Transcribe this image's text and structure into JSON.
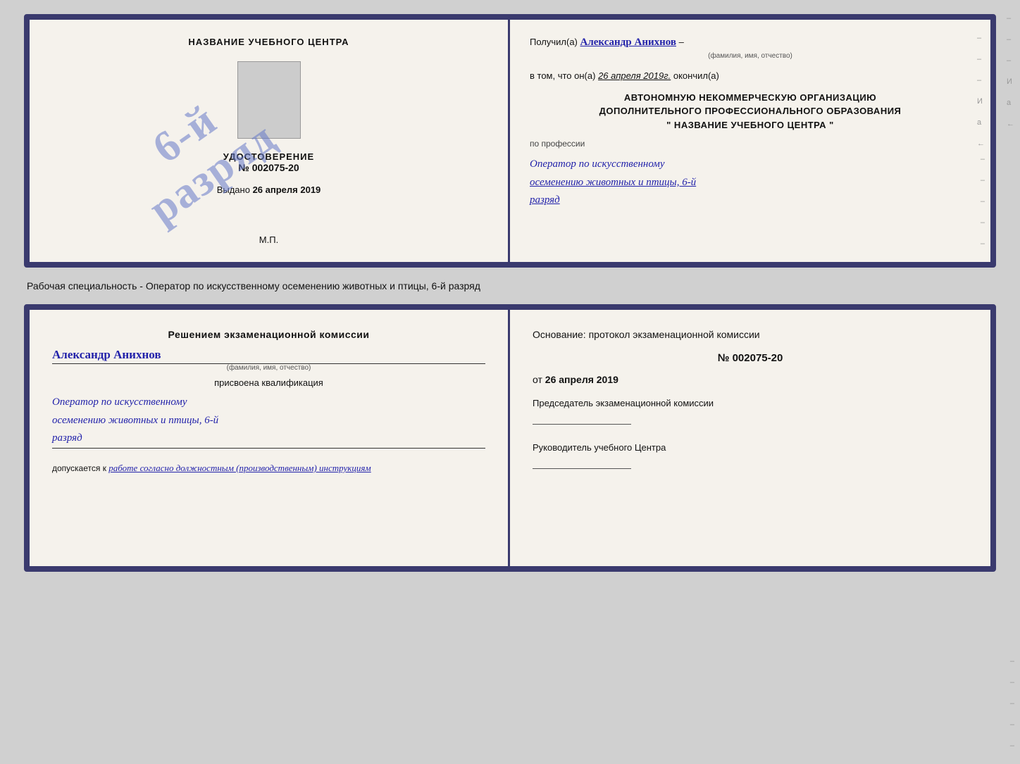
{
  "cert": {
    "left": {
      "title": "НАЗВАНИЕ УЧЕБНОГО ЦЕНТРА",
      "stamp_line1": "6-й",
      "stamp_line2": "разряд",
      "doc_label": "УДОСТОВЕРЕНИЕ",
      "doc_number": "№ 002075-20",
      "issued_label": "Выдано",
      "issued_date": "26 апреля 2019",
      "mp": "М.П."
    },
    "right": {
      "received_label": "Получил(а)",
      "recipient_name": "Александр Анихнов",
      "name_sub": "(фамилия, имя, отчество)",
      "dash1": "–",
      "in_that_label": "в том, что он(а)",
      "completion_date": "26 апреля 2019г.",
      "finished_label": "окончил(а)",
      "org_line1": "АВТОНОМНУЮ НЕКОММЕРЧЕСКУЮ ОРГАНИЗАЦИЮ",
      "org_line2": "ДОПОЛНИТЕЛЬНОГО ПРОФЕССИОНАЛЬНОГО ОБРАЗОВАНИЯ",
      "org_quote": "\"  НАЗВАНИЕ УЧЕБНОГО ЦЕНТРА  \"",
      "by_profession": "по профессии",
      "profession_line1": "Оператор по искусственному",
      "profession_line2": "осеменению животных и птицы, 6-й",
      "profession_line3": "разряд"
    }
  },
  "subtitle": "Рабочая специальность - Оператор по искусственному осеменению животных и птицы, 6-й разряд",
  "qual": {
    "left": {
      "heading": "Решением экзаменационной комиссии",
      "name": "Александр Анихнов",
      "name_sub": "(фамилия, имя, отчество)",
      "assigned_label": "присвоена квалификация",
      "profession_line1": "Оператор по искусственному",
      "profession_line2": "осеменению животных и птицы, 6-й",
      "profession_line3": "разряд",
      "allowed_label": "допускается к",
      "allowed_text": "работе согласно должностным (производственным) инструкциям"
    },
    "right": {
      "basis_label": "Основание: протокол экзаменационной комиссии",
      "number": "№  002075-20",
      "date_prefix": "от",
      "date": "26 апреля 2019",
      "chairman_label": "Председатель экзаменационной комиссии",
      "manager_label": "Руководитель учебного Центра"
    }
  },
  "side_marks": [
    "-",
    "-",
    "-",
    "И",
    "а",
    "←",
    "-",
    "-",
    "-",
    "-",
    "-"
  ]
}
